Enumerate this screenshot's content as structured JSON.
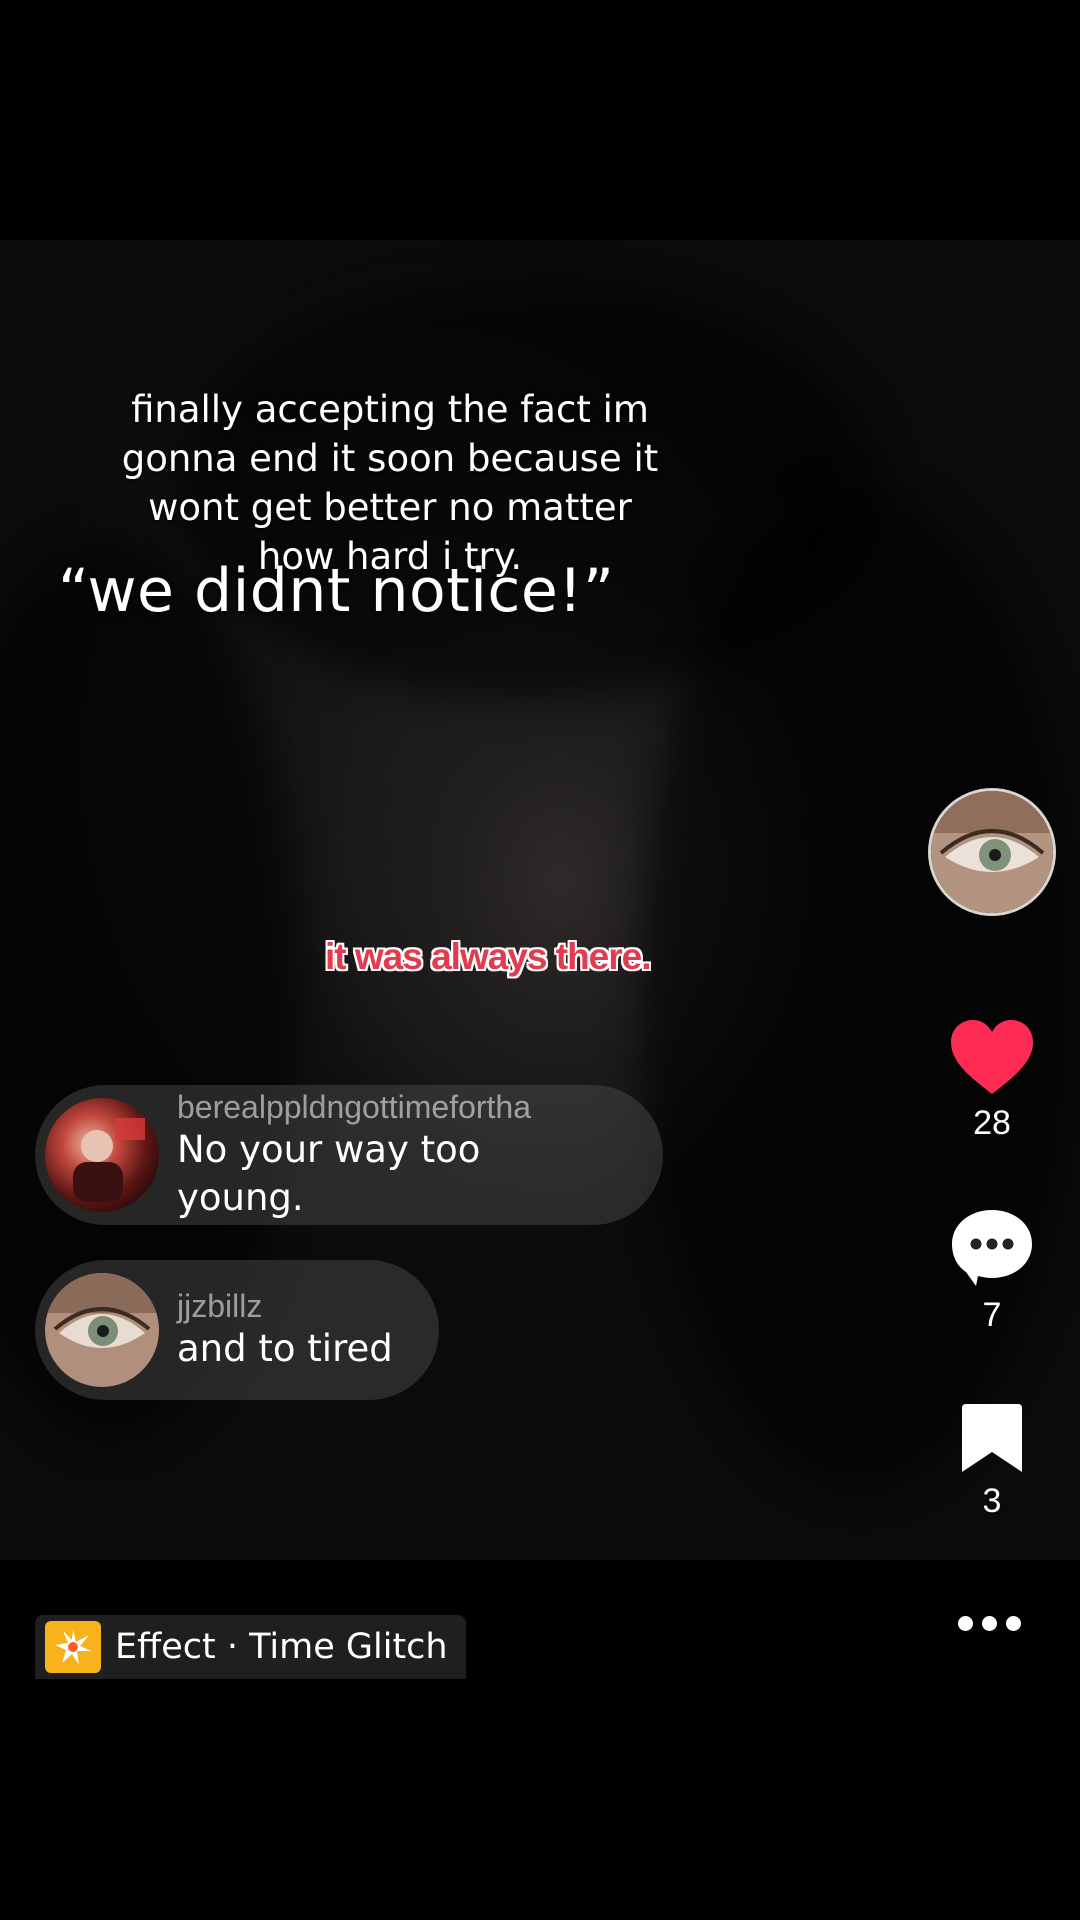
{
  "video": {
    "caption_top": "finally accepting the fact im gonna end it soon because it wont get better no matter how hard i try.",
    "caption_top_lines": [
      "finally accepting the fact im",
      "gonna end it soon because it",
      "wont get better no matter",
      "how hard i try."
    ],
    "caption_big": "“we didnt notice!”",
    "caption_red": "it was always there."
  },
  "comments": [
    {
      "username": "berealppldngottimefortha",
      "text": "No your way too young.",
      "avatar": "red-photo-avatar"
    },
    {
      "username": "jjzbillz",
      "text": "and to tired",
      "avatar": "eye-avatar"
    }
  ],
  "rail": {
    "avatar": "eye-avatar",
    "likes": "28",
    "comments": "7",
    "saves": "3",
    "like_color": "#fe2c55"
  },
  "effect": {
    "label": "Effect · Time Glitch",
    "icon": "sparkle-icon",
    "icon_bg": "#f7b21c"
  }
}
